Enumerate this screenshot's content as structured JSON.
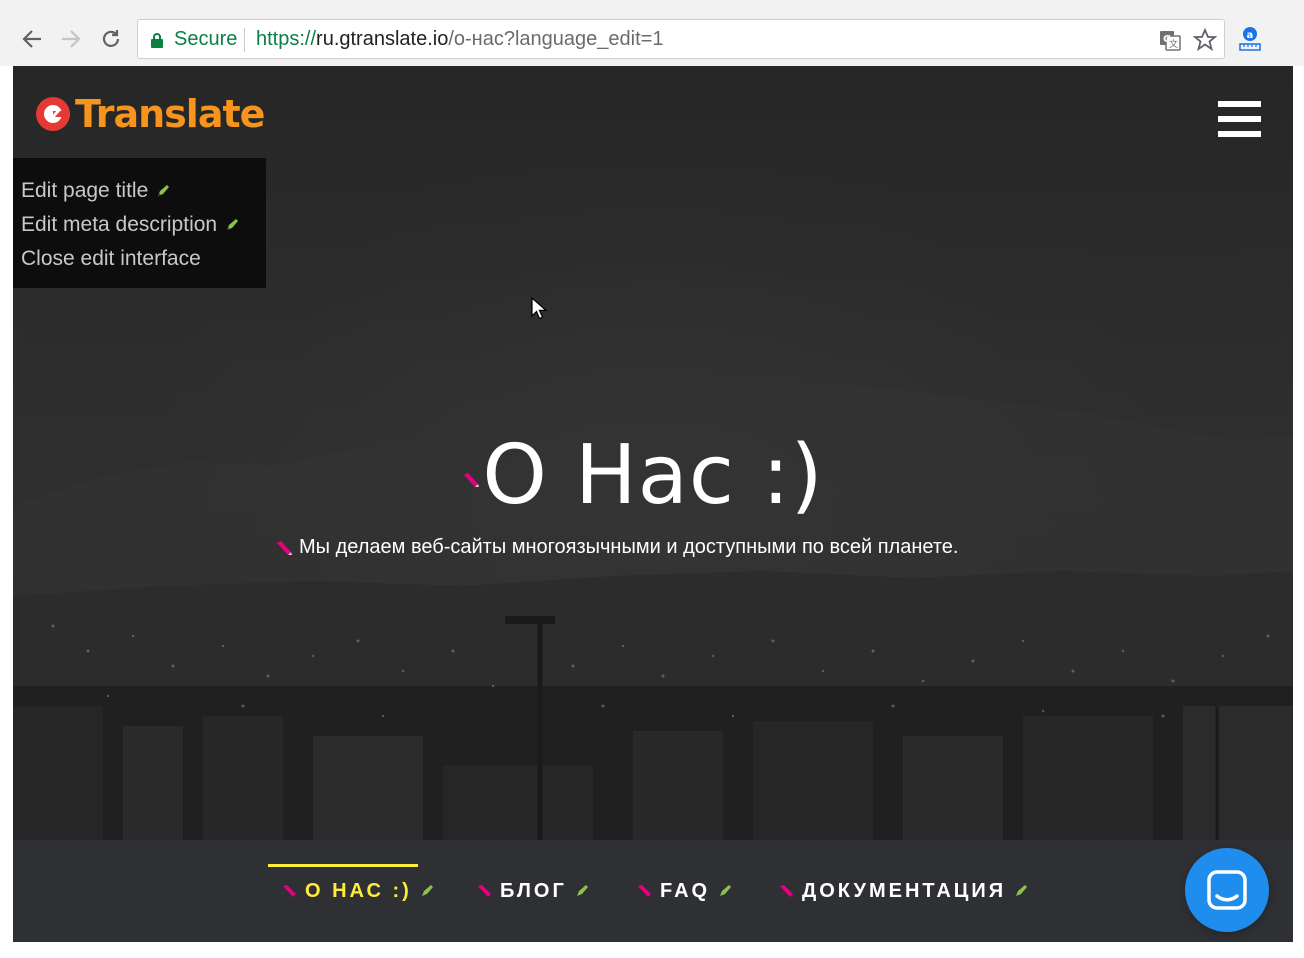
{
  "browser": {
    "secure_label": "Secure",
    "url_scheme": "https://",
    "url_host": "ru.gtranslate.io",
    "url_path": "/о-нас?language_edit=1"
  },
  "header": {
    "logo_text": "Translate"
  },
  "edit_menu": {
    "items": [
      {
        "label": "Edit page title",
        "icon": "pencil-icon"
      },
      {
        "label": "Edit meta description",
        "icon": "pencil-icon"
      },
      {
        "label": "Close edit interface"
      }
    ]
  },
  "hero": {
    "title": "О Нас :)",
    "subtitle": "Мы делаем веб-сайты многоязычными и доступными по всей планете."
  },
  "nav": {
    "items": [
      {
        "label": "О НАС :)",
        "active": true
      },
      {
        "label": "БЛОГ",
        "active": false
      },
      {
        "label": "FAQ",
        "active": false
      },
      {
        "label": "ДОКУМЕНТАЦИЯ",
        "active": false
      }
    ]
  },
  "colors": {
    "accent_yellow": "#ffeb3b",
    "logo_orange": "#f7941d",
    "chat_blue": "#1f8ded",
    "secure_green": "#0b8043",
    "edit_pink": "#e6007e",
    "edit_green": "#8bc34a"
  }
}
